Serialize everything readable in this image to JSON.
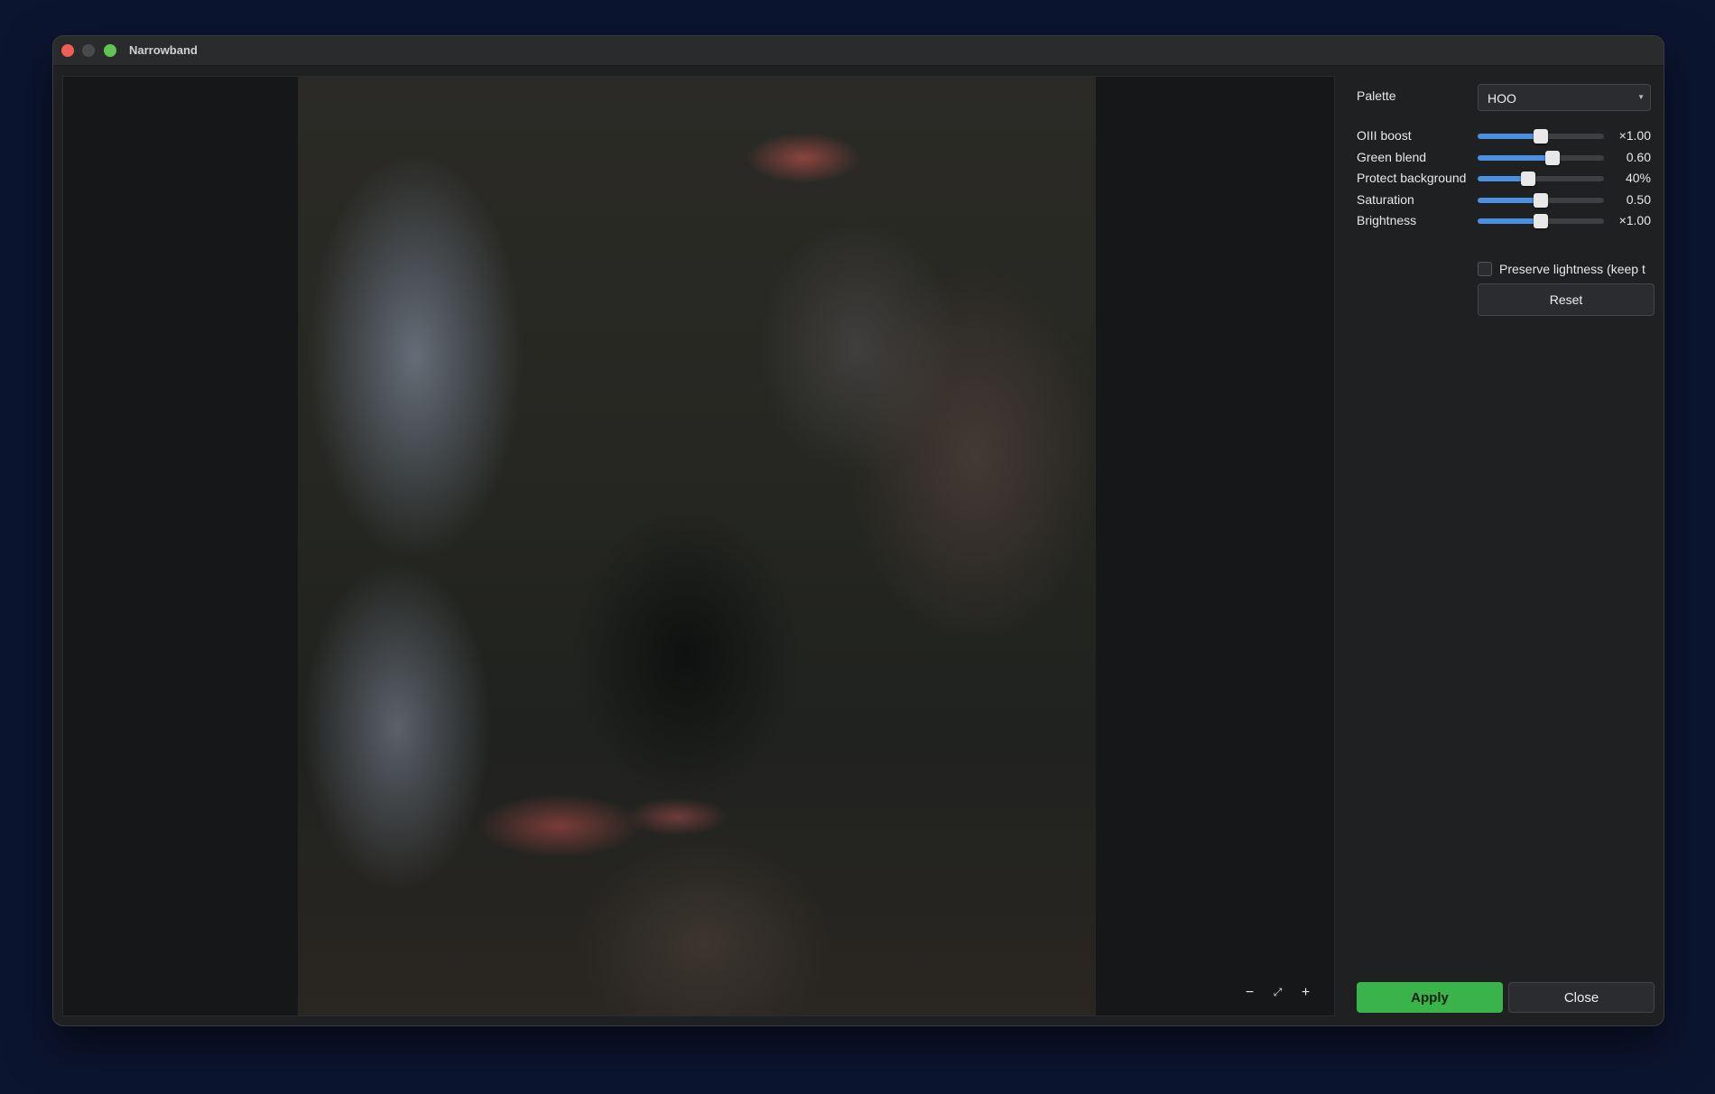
{
  "window": {
    "title": "Narrowband"
  },
  "viewer": {
    "zoom_out": "−",
    "zoom_fit": "⤢",
    "zoom_in": "+"
  },
  "panel": {
    "palette": {
      "label": "Palette",
      "value": "HOO"
    },
    "sliders": [
      {
        "label": "OIII boost",
        "value": "×1.00",
        "level": 0.5
      },
      {
        "label": "Green blend",
        "value": "0.60",
        "level": 0.59
      },
      {
        "label": "Protect background",
        "value": "40%",
        "level": 0.4
      },
      {
        "label": "Saturation",
        "value": "0.50",
        "level": 0.5
      },
      {
        "label": "Brightness",
        "value": "×1.00",
        "level": 0.5
      }
    ],
    "preserve_lightness": {
      "label": "Preserve lightness (keep t",
      "checked": false
    },
    "reset_label": "Reset",
    "apply_label": "Apply",
    "close_label": "Close"
  },
  "colors": {
    "accent_slider": "#4a8fe0",
    "apply_green": "#3ab44a",
    "background": "#0c1530"
  }
}
